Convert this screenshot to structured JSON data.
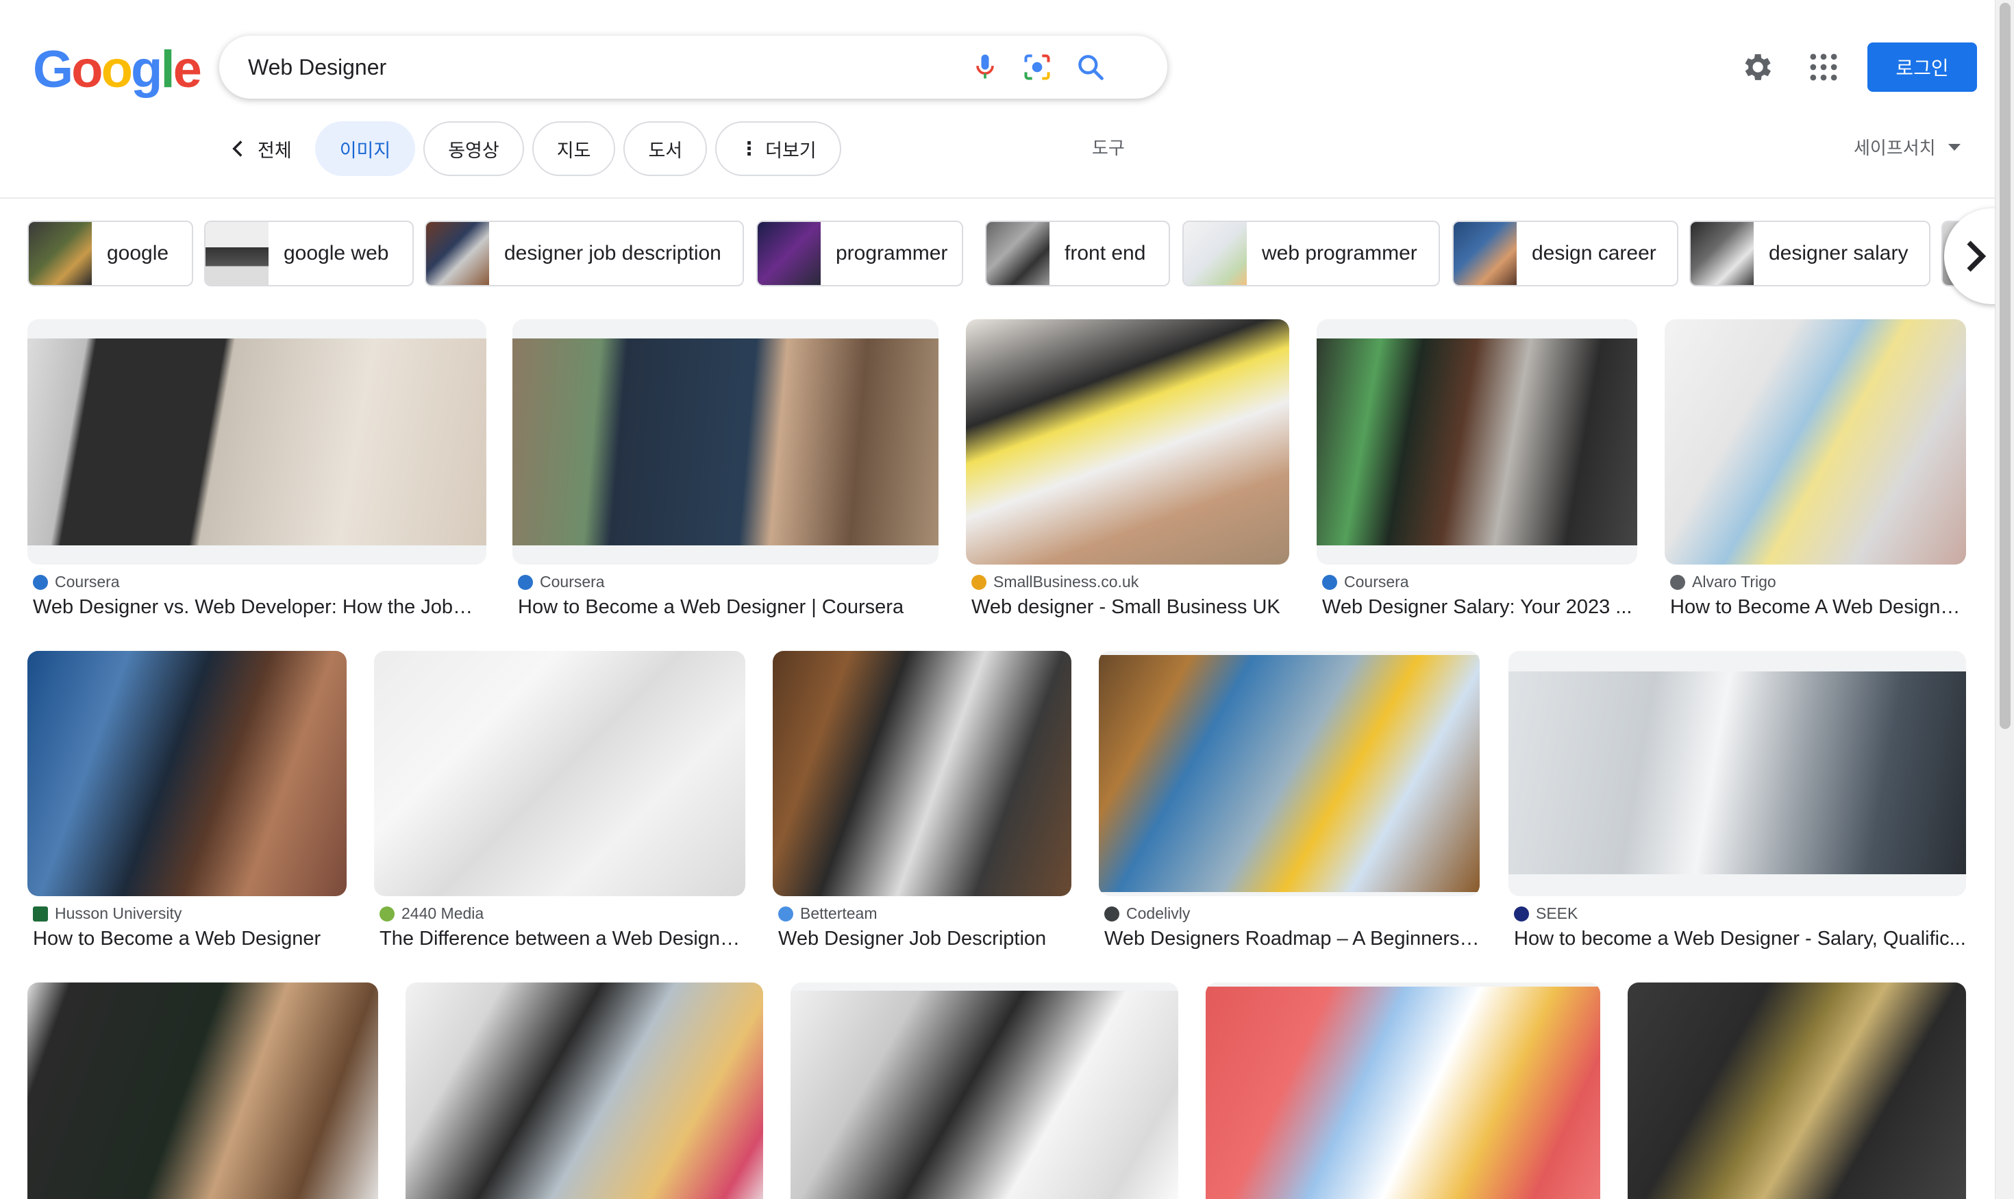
{
  "logo": {
    "letters": [
      "G",
      "o",
      "o",
      "g",
      "l",
      "e"
    ],
    "colors": [
      "#4285f4",
      "#ea4335",
      "#fbbc05",
      "#4285f4",
      "#34a853",
      "#ea4335"
    ]
  },
  "search": {
    "query": "Web Designer",
    "icons": [
      "mic-icon",
      "lens-icon",
      "search-icon"
    ]
  },
  "header": {
    "login_label": "로그인",
    "settings_icon": "gear-icon",
    "apps_icon": "grid-icon"
  },
  "tabs": [
    {
      "label": "전체",
      "icon": "chevron-left-icon"
    },
    {
      "label": "이미지",
      "active": true
    },
    {
      "label": "동영상"
    },
    {
      "label": "지도"
    },
    {
      "label": "도서"
    },
    {
      "label": "더보기",
      "icon": "more-vert-icon"
    }
  ],
  "tools_label": "도구",
  "safesearch_label": "세이프서치",
  "chips": [
    {
      "label": "google"
    },
    {
      "label": "google web"
    },
    {
      "label": "designer job description"
    },
    {
      "label": "programmer"
    },
    {
      "label": "front end"
    },
    {
      "label": "web programmer"
    },
    {
      "label": "design career"
    },
    {
      "label": "designer salary"
    }
  ],
  "results": [
    {
      "source": "Coursera",
      "title": "Web Designer vs. Web Developer: How the Jobs ...",
      "favicon_color": "#2a73cc"
    },
    {
      "source": "Coursera",
      "title": "How to Become a Web Designer | Coursera",
      "favicon_color": "#2a73cc"
    },
    {
      "source": "SmallBusiness.co.uk",
      "title": "Web designer - Small Business UK",
      "favicon_color": "#e8a21a"
    },
    {
      "source": "Coursera",
      "title": "Web Designer Salary: Your 2023 ...",
      "favicon_color": "#2a73cc"
    },
    {
      "source": "Alvaro Trigo",
      "title": "How to Become A Web Designe...",
      "favicon_color": "#5f6368"
    },
    {
      "source": "Husson University",
      "title": "How to Become a Web Designer",
      "favicon_color": "#1e6b3a"
    },
    {
      "source": "2440 Media",
      "title": "The Difference between a Web Designe...",
      "favicon_color": "#7cb342"
    },
    {
      "source": "Betterteam",
      "title": "Web Designer Job Description",
      "favicon_color": "#4a90e2"
    },
    {
      "source": "Codelivly",
      "title": "Web Designers Roadmap – A Beginners ...",
      "favicon_color": "#3c4043"
    },
    {
      "source": "SEEK",
      "title": "How to become a Web Designer - Salary, Qualific...",
      "favicon_color": "#1b2a7a"
    }
  ]
}
